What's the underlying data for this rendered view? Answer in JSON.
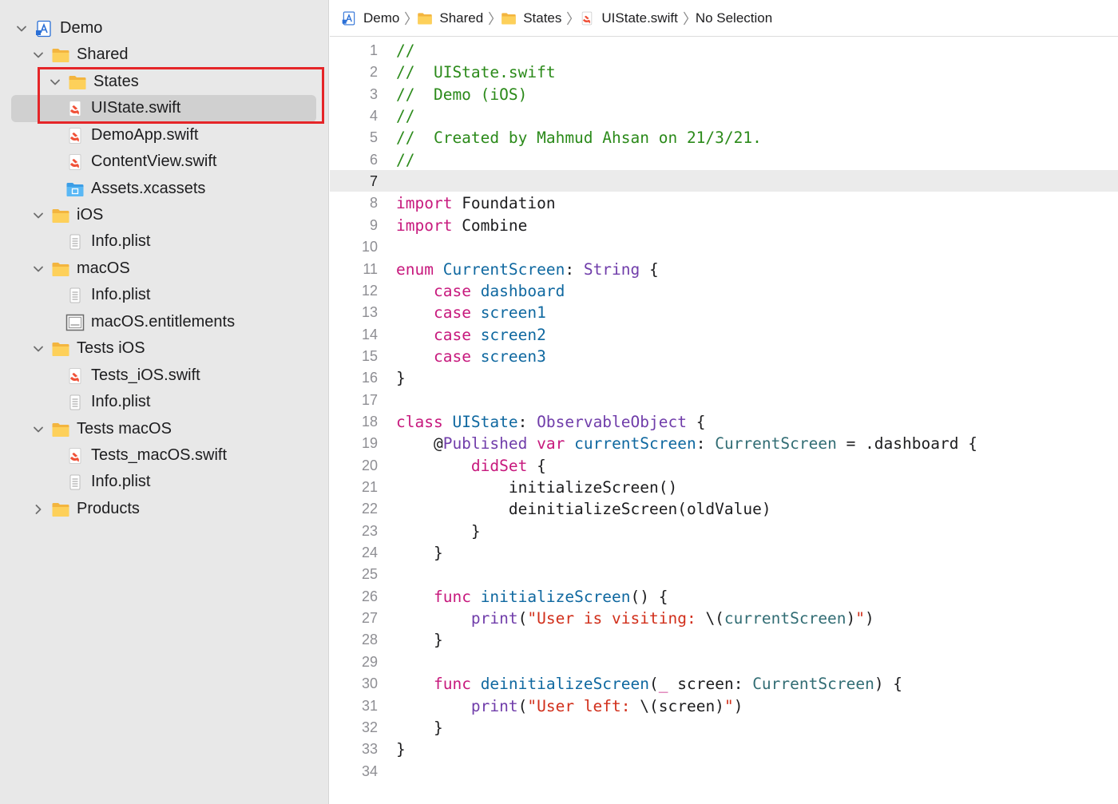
{
  "colors": {
    "selection_outline": "#e52528",
    "folder": "#f7c244",
    "swift": "#f05138",
    "comment": "#2b8a1a",
    "keyword": "#c7197d",
    "type_name": "#0b4f79",
    "declaration": "#0f68a0",
    "string": "#d12f1b",
    "project_type": "#326d74"
  },
  "sidebar": {
    "items": [
      {
        "label": "Demo",
        "icon": "xcode-project-icon",
        "expanded": true
      },
      {
        "label": "Shared",
        "icon": "folder-icon",
        "expanded": true
      },
      {
        "label": "States",
        "icon": "folder-icon",
        "expanded": true
      },
      {
        "label": "UIState.swift",
        "icon": "swift-file-icon",
        "selected": true
      },
      {
        "label": "DemoApp.swift",
        "icon": "swift-file-icon"
      },
      {
        "label": "ContentView.swift",
        "icon": "swift-file-icon"
      },
      {
        "label": "Assets.xcassets",
        "icon": "asset-catalog-icon"
      },
      {
        "label": "iOS",
        "icon": "folder-icon",
        "expanded": true
      },
      {
        "label": "Info.plist",
        "icon": "plist-file-icon"
      },
      {
        "label": "macOS",
        "icon": "folder-icon",
        "expanded": true
      },
      {
        "label": "Info.plist",
        "icon": "plist-file-icon"
      },
      {
        "label": "macOS.entitlements",
        "icon": "entitlements-file-icon"
      },
      {
        "label": "Tests iOS",
        "icon": "folder-icon",
        "expanded": true
      },
      {
        "label": "Tests_iOS.swift",
        "icon": "swift-file-icon"
      },
      {
        "label": "Info.plist",
        "icon": "plist-file-icon"
      },
      {
        "label": "Tests macOS",
        "icon": "folder-icon",
        "expanded": true
      },
      {
        "label": "Tests_macOS.swift",
        "icon": "swift-file-icon"
      },
      {
        "label": "Info.plist",
        "icon": "plist-file-icon"
      },
      {
        "label": "Products",
        "icon": "folder-icon",
        "expanded": false
      }
    ]
  },
  "jumpbar": {
    "crumbs": [
      {
        "label": "Demo",
        "icon": "xcode-project-icon"
      },
      {
        "label": "Shared",
        "icon": "folder-icon"
      },
      {
        "label": "States",
        "icon": "folder-icon"
      },
      {
        "label": "UIState.swift",
        "icon": "swift-file-icon"
      },
      {
        "label": "No Selection",
        "icon": ""
      }
    ]
  },
  "editor": {
    "current_line": 7,
    "lines": [
      {
        "n": "1",
        "tokens": [
          [
            "c",
            "//"
          ]
        ]
      },
      {
        "n": "2",
        "tokens": [
          [
            "c",
            "//  UIState.swift"
          ]
        ]
      },
      {
        "n": "3",
        "tokens": [
          [
            "c",
            "//  Demo (iOS)"
          ]
        ]
      },
      {
        "n": "4",
        "tokens": [
          [
            "c",
            "//"
          ]
        ]
      },
      {
        "n": "5",
        "tokens": [
          [
            "c",
            "//  Created by Mahmud Ahsan on 21/3/21."
          ]
        ]
      },
      {
        "n": "6",
        "tokens": [
          [
            "c",
            "//"
          ]
        ]
      },
      {
        "n": "7",
        "tokens": []
      },
      {
        "n": "8",
        "tokens": [
          [
            "k",
            "import"
          ],
          [
            "p",
            " Foundation"
          ]
        ]
      },
      {
        "n": "9",
        "tokens": [
          [
            "k",
            "import"
          ],
          [
            "p",
            " Combine"
          ]
        ]
      },
      {
        "n": "10",
        "tokens": []
      },
      {
        "n": "11",
        "tokens": [
          [
            "k",
            "enum"
          ],
          [
            "p",
            " "
          ],
          [
            "d",
            "CurrentScreen"
          ],
          [
            "p",
            ": "
          ],
          [
            "t2",
            "String"
          ],
          [
            "p",
            " {"
          ]
        ]
      },
      {
        "n": "12",
        "tokens": [
          [
            "p",
            "    "
          ],
          [
            "k",
            "case"
          ],
          [
            "p",
            " "
          ],
          [
            "d",
            "dashboard"
          ]
        ]
      },
      {
        "n": "13",
        "tokens": [
          [
            "p",
            "    "
          ],
          [
            "k",
            "case"
          ],
          [
            "p",
            " "
          ],
          [
            "d",
            "screen1"
          ]
        ]
      },
      {
        "n": "14",
        "tokens": [
          [
            "p",
            "    "
          ],
          [
            "k",
            "case"
          ],
          [
            "p",
            " "
          ],
          [
            "d",
            "screen2"
          ]
        ]
      },
      {
        "n": "15",
        "tokens": [
          [
            "p",
            "    "
          ],
          [
            "k",
            "case"
          ],
          [
            "p",
            " "
          ],
          [
            "d",
            "screen3"
          ]
        ]
      },
      {
        "n": "16",
        "tokens": [
          [
            "p",
            "}"
          ]
        ]
      },
      {
        "n": "17",
        "tokens": []
      },
      {
        "n": "18",
        "tokens": [
          [
            "k",
            "class"
          ],
          [
            "p",
            " "
          ],
          [
            "d",
            "UIState"
          ],
          [
            "p",
            ": "
          ],
          [
            "t2",
            "ObservableObject"
          ],
          [
            "p",
            " {"
          ]
        ]
      },
      {
        "n": "19",
        "tokens": [
          [
            "p",
            "    @"
          ],
          [
            "t2",
            "Published"
          ],
          [
            "p",
            " "
          ],
          [
            "k",
            "var"
          ],
          [
            "p",
            " "
          ],
          [
            "d",
            "currentScreen"
          ],
          [
            "p",
            ": "
          ],
          [
            "pr",
            "CurrentScreen"
          ],
          [
            "p",
            " = .dashboard {"
          ]
        ]
      },
      {
        "n": "20",
        "tokens": [
          [
            "p",
            "        "
          ],
          [
            "k",
            "didSet"
          ],
          [
            "p",
            " {"
          ]
        ]
      },
      {
        "n": "21",
        "tokens": [
          [
            "p",
            "            initializeScreen()"
          ]
        ]
      },
      {
        "n": "22",
        "tokens": [
          [
            "p",
            "            deinitializeScreen(oldValue)"
          ]
        ]
      },
      {
        "n": "23",
        "tokens": [
          [
            "p",
            "        }"
          ]
        ]
      },
      {
        "n": "24",
        "tokens": [
          [
            "p",
            "    }"
          ]
        ]
      },
      {
        "n": "25",
        "tokens": []
      },
      {
        "n": "26",
        "tokens": [
          [
            "p",
            "    "
          ],
          [
            "k",
            "func"
          ],
          [
            "p",
            " "
          ],
          [
            "d",
            "initializeScreen"
          ],
          [
            "p",
            "() {"
          ]
        ]
      },
      {
        "n": "27",
        "tokens": [
          [
            "p",
            "        "
          ],
          [
            "t2",
            "print"
          ],
          [
            "p",
            "("
          ],
          [
            "s",
            "\"User is visiting: "
          ],
          [
            "p",
            "\\("
          ],
          [
            "pr",
            "currentScreen"
          ],
          [
            "p",
            ")"
          ],
          [
            "s",
            "\""
          ],
          [
            "p",
            ")"
          ]
        ]
      },
      {
        "n": "28",
        "tokens": [
          [
            "p",
            "    }"
          ]
        ]
      },
      {
        "n": "29",
        "tokens": []
      },
      {
        "n": "30",
        "tokens": [
          [
            "p",
            "    "
          ],
          [
            "k",
            "func"
          ],
          [
            "p",
            " "
          ],
          [
            "d",
            "deinitializeScreen"
          ],
          [
            "p",
            "("
          ],
          [
            "k",
            "_"
          ],
          [
            "p",
            " screen: "
          ],
          [
            "pr",
            "CurrentScreen"
          ],
          [
            "p",
            ") {"
          ]
        ]
      },
      {
        "n": "31",
        "tokens": [
          [
            "p",
            "        "
          ],
          [
            "t2",
            "print"
          ],
          [
            "p",
            "("
          ],
          [
            "s",
            "\"User left: "
          ],
          [
            "p",
            "\\(screen)"
          ],
          [
            "s",
            "\""
          ],
          [
            "p",
            ")"
          ]
        ]
      },
      {
        "n": "32",
        "tokens": [
          [
            "p",
            "    }"
          ]
        ]
      },
      {
        "n": "33",
        "tokens": [
          [
            "p",
            "}"
          ]
        ]
      },
      {
        "n": "34",
        "tokens": []
      }
    ]
  }
}
